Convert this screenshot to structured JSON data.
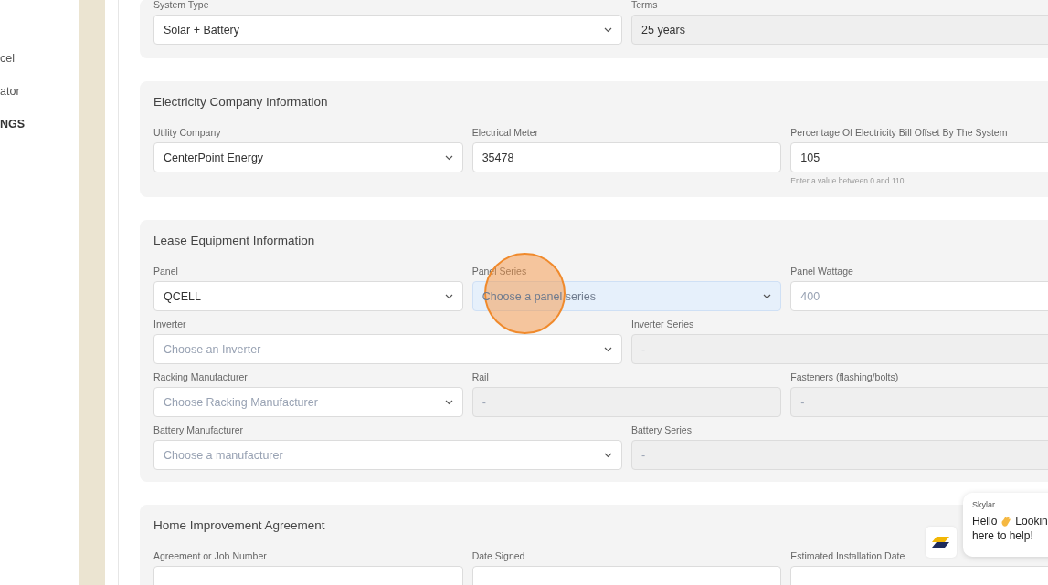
{
  "sidebar": {
    "items": [
      {
        "label": "cel",
        "selected": false
      },
      {
        "label": "ator",
        "selected": false
      },
      {
        "label": "NGS",
        "selected": true
      }
    ]
  },
  "sections": [
    {
      "rows": [
        [
          {
            "label": "System Type",
            "kind": "select",
            "value": "Solar + Battery",
            "disabled": false,
            "focused": false
          },
          {
            "label": "Terms",
            "kind": "input",
            "value": "25 years",
            "disabled": true,
            "focused": false
          }
        ]
      ]
    },
    {
      "title": "Electricity Company Information",
      "rows": [
        [
          {
            "label": "Utility Company",
            "kind": "select",
            "value": "CenterPoint Energy",
            "disabled": false,
            "focused": false
          },
          {
            "label": "Electrical Meter",
            "kind": "input",
            "value": "35478",
            "disabled": false,
            "focused": false
          },
          {
            "label": "Percentage Of Electricity Bill Offset By The System",
            "kind": "input",
            "value": "105",
            "disabled": false,
            "focused": false,
            "helper": "Enter a value between 0 and 110"
          }
        ]
      ]
    },
    {
      "title": "Lease Equipment Information",
      "rows": [
        [
          {
            "label": "Panel",
            "kind": "select",
            "value": "QCELL",
            "disabled": false,
            "focused": false
          },
          {
            "label": "Panel Series",
            "kind": "select",
            "placeholder": "Choose a panel series",
            "disabled": false,
            "focused": true
          },
          {
            "label": "Panel Wattage",
            "kind": "input",
            "placeholder": "400",
            "disabled": false,
            "focused": false
          }
        ],
        [
          {
            "label": "Inverter",
            "kind": "select",
            "placeholder": "Choose an Inverter",
            "disabled": false,
            "focused": false
          },
          {
            "label": "Inverter Series",
            "kind": "input",
            "placeholder": "-",
            "disabled": true,
            "focused": false
          }
        ],
        [
          {
            "label": "Racking Manufacturer",
            "kind": "select",
            "placeholder": "Choose Racking Manufacturer",
            "disabled": false,
            "focused": false
          },
          {
            "label": "Rail",
            "kind": "input",
            "placeholder": "-",
            "disabled": true,
            "focused": false
          },
          {
            "label": "Fasteners (flashing/bolts)",
            "kind": "input",
            "placeholder": "-",
            "disabled": true,
            "focused": false
          }
        ],
        [
          {
            "label": "Battery Manufacturer",
            "kind": "select",
            "placeholder": "Choose a manufacturer",
            "disabled": false,
            "focused": false
          },
          {
            "label": "Battery Series",
            "kind": "input",
            "placeholder": "-",
            "disabled": true,
            "focused": false
          }
        ]
      ]
    },
    {
      "title": "Home Improvement Agreement",
      "rows": [
        [
          {
            "label": "Agreement or Job Number",
            "kind": "input",
            "disabled": false,
            "focused": false
          },
          {
            "label": "Date Signed",
            "kind": "date",
            "disabled": false,
            "focused": false
          },
          {
            "label": "Estimated Installation Date",
            "kind": "date",
            "disabled": false,
            "focused": false
          }
        ]
      ]
    }
  ],
  "chat": {
    "sender": "Skylar",
    "line1_start": "Hello",
    "line1_end": "Lookin",
    "line2": "here to help!"
  }
}
